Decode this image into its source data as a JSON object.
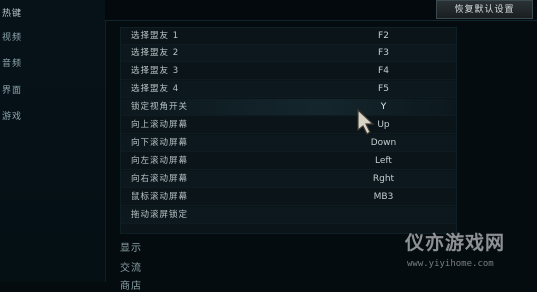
{
  "sidebar": {
    "items": [
      {
        "label": "热键"
      },
      {
        "label": "视频"
      },
      {
        "label": "音频"
      },
      {
        "label": "界面"
      },
      {
        "label": "游戏"
      }
    ]
  },
  "toolbar": {
    "restore_label": "恢复默认设置"
  },
  "rows": [
    {
      "label": "选择盟友 1",
      "key": "F2"
    },
    {
      "label": "选择盟友 2",
      "key": "F3"
    },
    {
      "label": "选择盟友 3",
      "key": "F4"
    },
    {
      "label": "选择盟友 4",
      "key": "F5"
    },
    {
      "label": "锁定视角开关",
      "key": "Y"
    },
    {
      "label": "向上滚动屏幕",
      "key": "Up"
    },
    {
      "label": "向下滚动屏幕",
      "key": "Down"
    },
    {
      "label": "向左滚动屏幕",
      "key": "Left"
    },
    {
      "label": "向右滚动屏幕",
      "key": "Rght"
    },
    {
      "label": "鼠标滚动屏幕",
      "key": "MB3"
    },
    {
      "label": "拖动滚屏锁定",
      "key": ""
    }
  ],
  "sections": [
    {
      "label": "显示"
    },
    {
      "label": "交流"
    },
    {
      "label": "商店"
    }
  ],
  "watermark": {
    "title": "仪亦游戏网",
    "url": "www.yiyihome.com"
  },
  "icons": {
    "cursor": "pointer-cursor-icon"
  }
}
